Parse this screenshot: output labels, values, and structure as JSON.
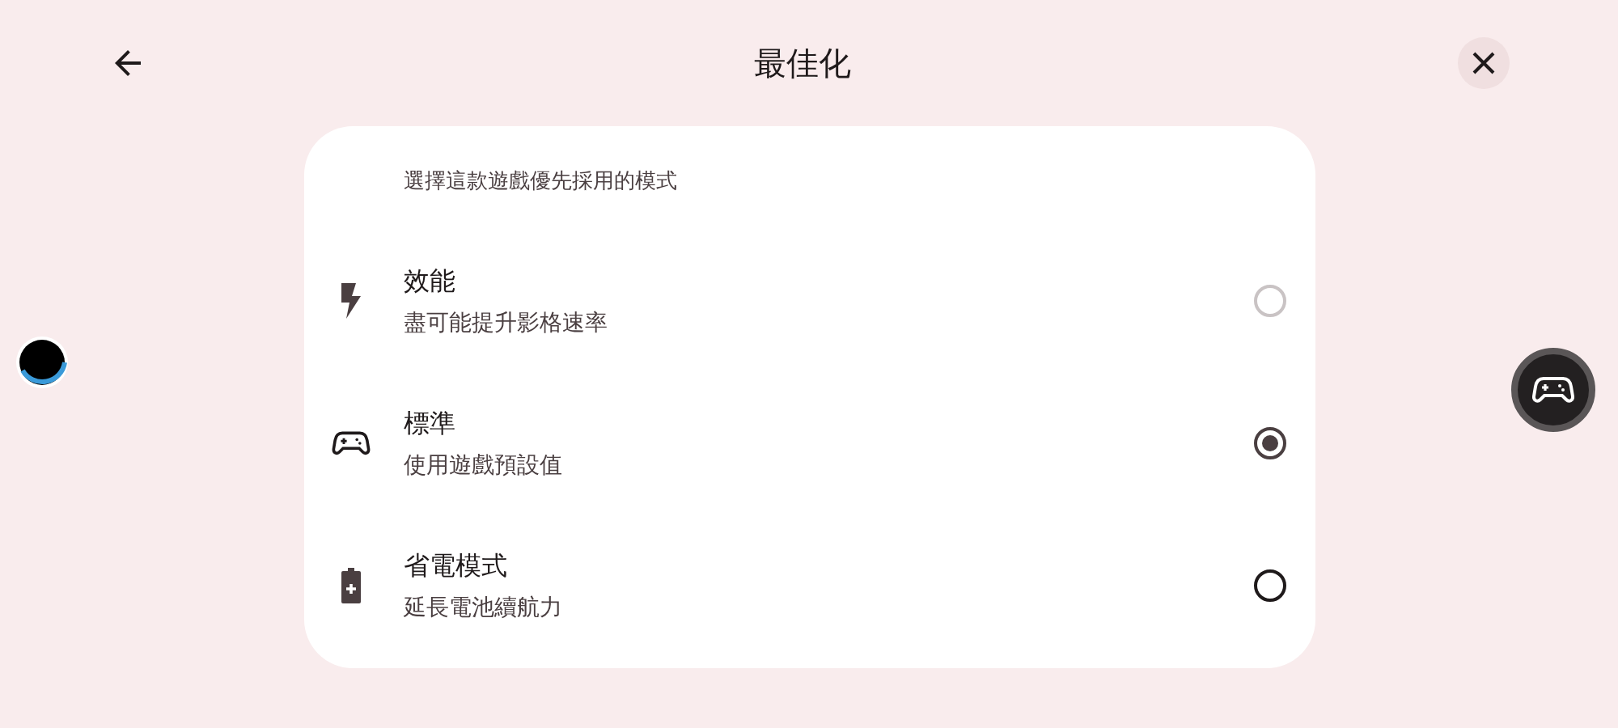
{
  "header": {
    "title": "最佳化"
  },
  "card": {
    "subtitle": "選擇這款遊戲優先採用的模式",
    "options": [
      {
        "kind": "performance",
        "title": "效能",
        "description": "盡可能提升影格速率",
        "selected": false,
        "disabled": true
      },
      {
        "kind": "standard",
        "title": "標準",
        "description": "使用遊戲預設值",
        "selected": true,
        "disabled": false
      },
      {
        "kind": "battery",
        "title": "省電模式",
        "description": "延長電池續航力",
        "selected": false,
        "disabled": false
      }
    ]
  }
}
